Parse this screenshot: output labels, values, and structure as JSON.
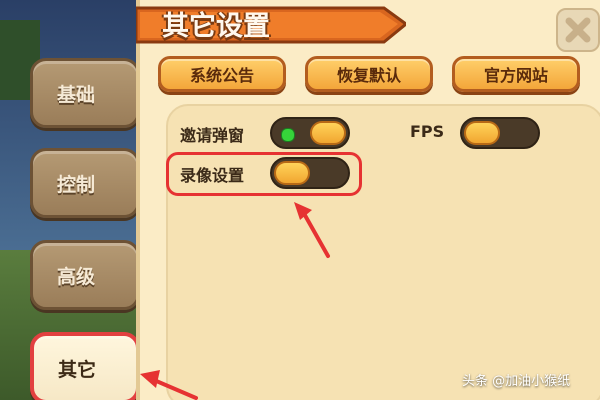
{
  "window": {
    "title": "其它设置"
  },
  "tabs": [
    {
      "label": "基础",
      "active": false
    },
    {
      "label": "控制",
      "active": false
    },
    {
      "label": "高级",
      "active": false
    },
    {
      "label": "其它",
      "active": true
    }
  ],
  "header_buttons": [
    {
      "label": "系统公告"
    },
    {
      "label": "恢复默认"
    },
    {
      "label": "官方网站"
    }
  ],
  "settings": {
    "invite_popup": {
      "label": "邀请弹窗",
      "state": "on"
    },
    "fps": {
      "label": "FPS",
      "state": "on"
    },
    "recording": {
      "label": "录像设置",
      "state": "off"
    }
  },
  "watermark": "头条 @加油小猴纸",
  "colors": {
    "highlight": "#e63232",
    "accent": "#f3a63a",
    "panel": "#fbecc6",
    "indicator_on": "#36d43a"
  },
  "icons": {
    "close": "close-icon"
  }
}
